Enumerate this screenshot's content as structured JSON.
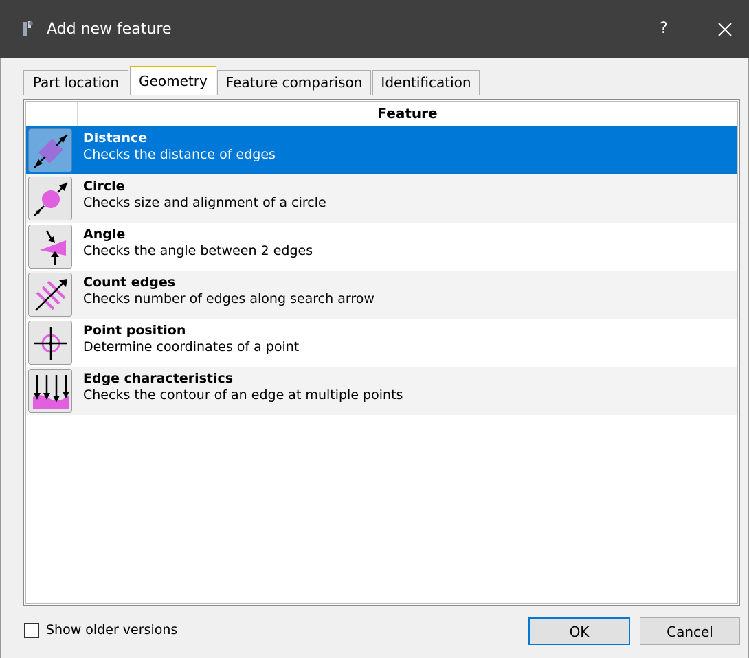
{
  "window": {
    "title": "Add new feature",
    "help_label": "?",
    "app_icon": "app-icon",
    "close_icon": "close-icon"
  },
  "tabs": [
    {
      "label": "Part location",
      "active": false
    },
    {
      "label": "Geometry",
      "active": true
    },
    {
      "label": "Feature comparison",
      "active": false
    },
    {
      "label": "Identification",
      "active": false
    }
  ],
  "table": {
    "header": "Feature",
    "rows": [
      {
        "title": "Distance",
        "description": "Checks the distance of edges",
        "icon": "distance-icon",
        "selected": true
      },
      {
        "title": "Circle",
        "description": "Checks size and alignment of a circle",
        "icon": "circle-icon",
        "selected": false
      },
      {
        "title": "Angle",
        "description": "Checks the angle between 2 edges",
        "icon": "angle-icon",
        "selected": false
      },
      {
        "title": "Count edges",
        "description": "Checks number of edges along search arrow",
        "icon": "count-edges-icon",
        "selected": false
      },
      {
        "title": "Point position",
        "description": "Determine coordinates of a point",
        "icon": "point-position-icon",
        "selected": false
      },
      {
        "title": "Edge characteristics",
        "description": "Checks the contour of an edge at multiple points",
        "icon": "edge-characteristics-icon",
        "selected": false
      }
    ]
  },
  "footer": {
    "show_older_label": "Show older versions",
    "show_older_checked": false,
    "ok_label": "OK",
    "cancel_label": "Cancel"
  },
  "colors": {
    "titlebar": "#3f3f3f",
    "selection": "#0078d7",
    "icon_accent": "#e060e0"
  }
}
